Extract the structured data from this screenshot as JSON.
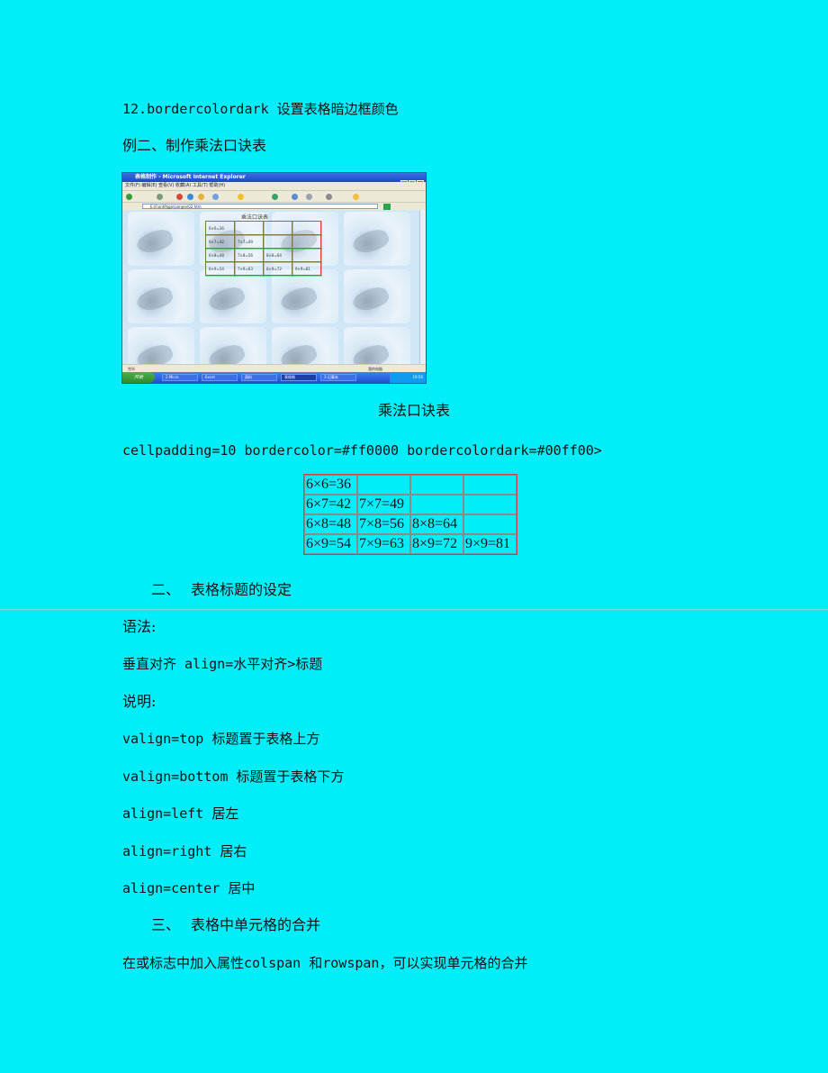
{
  "lines": {
    "l12": "12.bordercolordark 设置表格暗边框颜色",
    "example2": "例二、制作乘法口诀表",
    "caption": "乘法口诀表",
    "code": "cellpadding=10 bordercolor=#ff0000 bordercolordark=#00ff00>",
    "sec2_num": "二、",
    "sec2_title": "表格标题的设定",
    "syntax": "语法:",
    "syntax_code": "垂直对齐 align=水平对齐>标题",
    "explain": "说明:",
    "valign_top": "valign=top 标题置于表格上方",
    "valign_bottom": "valign=bottom 标题置于表格下方",
    "align_left": "align=left 居左",
    "align_right": "align=right 居右",
    "align_center": "align=center 居中",
    "sec3_num": "三、",
    "sec3_title": "表格中单元格的合并",
    "merge": "在或标志中加入属性colspan 和rowspan，可以实现单元格的合并"
  },
  "table": {
    "rows": [
      [
        "6×6=36",
        "",
        "",
        ""
      ],
      [
        "6×7=42",
        "7×7=49",
        "",
        ""
      ],
      [
        "6×8=48",
        "7×8=56",
        "8×8=64",
        ""
      ],
      [
        "6×9=54",
        "7×9=63",
        "8×9=72",
        "9×9=81"
      ]
    ]
  },
  "screenshot": {
    "window_title": "表格制作 - Microsoft Internet Explorer",
    "menu": "文件(F)  编辑(E)  查看(V)  收藏(A)  工具(T)  帮助(H)",
    "address": "E:\\FrontPage\\sample\\02.htm",
    "page_title": "乘法口诀表",
    "rows": [
      [
        "6×6=36",
        "",
        "",
        ""
      ],
      [
        "6×7=42",
        "7×7=49",
        "",
        ""
      ],
      [
        "6×8=48",
        "7×8=56",
        "8×8=64",
        ""
      ],
      [
        "6×9=54",
        "7×9=63",
        "8×9=72",
        "9×9=81"
      ]
    ],
    "status_left": "完毕",
    "status_right": "我的电脑",
    "start": "开始",
    "tasks": [
      "2 Micro",
      "Excel",
      "面料",
      "表格制",
      "3 记事本"
    ],
    "clock": "19:56"
  }
}
